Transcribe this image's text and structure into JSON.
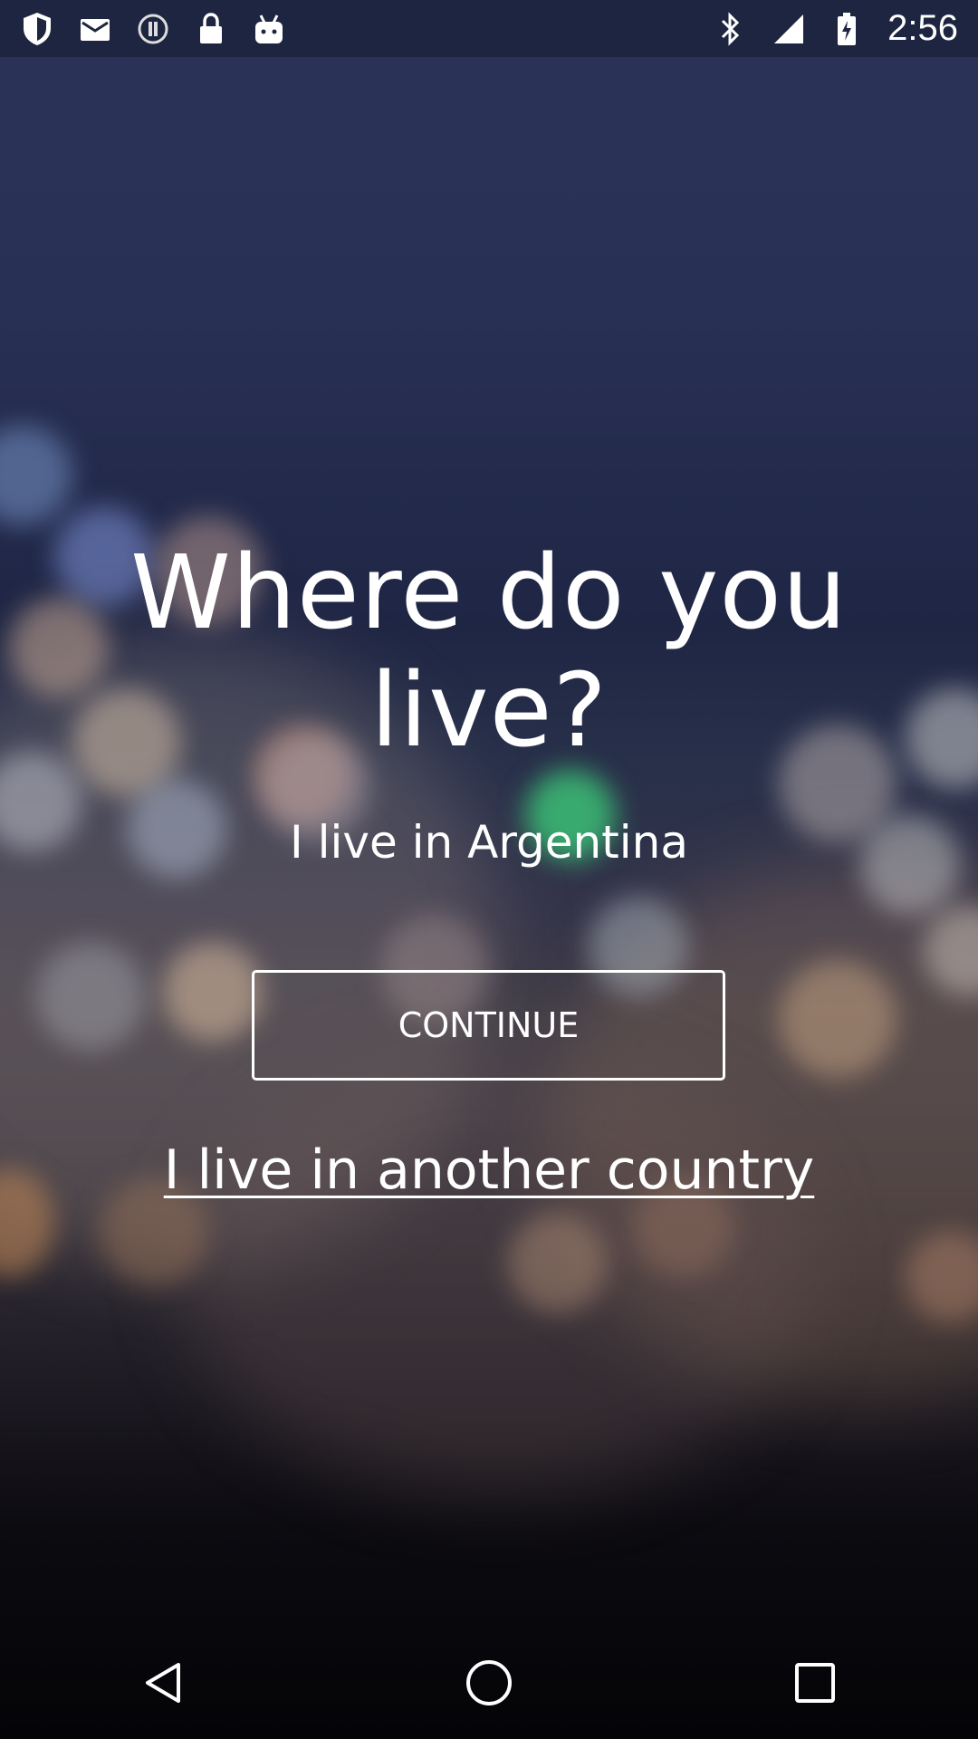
{
  "status_bar": {
    "time": "2:56",
    "left_icons": [
      "shield-icon",
      "mail-icon",
      "info-circle-icon",
      "lock-icon",
      "android-icon"
    ],
    "right_icons": [
      "bluetooth-icon",
      "signal-icon",
      "battery-icon"
    ]
  },
  "main": {
    "title": "Where do you live?",
    "current_country_label": "I live in Argentina",
    "continue_label": "CONTINUE",
    "other_country_label": "I live in another country"
  },
  "nav_bar": {
    "icons": [
      "back-icon",
      "home-icon",
      "recents-icon"
    ]
  },
  "colors": {
    "text": "#ffffff",
    "status_bar_bg": "#1e2540"
  }
}
